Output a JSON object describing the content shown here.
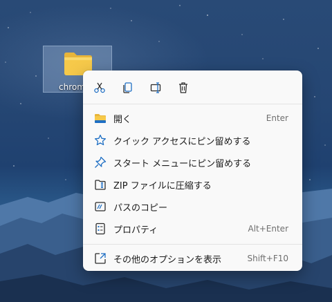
{
  "desktop": {
    "icon_label": "chrom"
  },
  "menu": {
    "toolbar": [
      {
        "name": "cut-icon",
        "label": "Cut"
      },
      {
        "name": "copy-icon",
        "label": "Copy"
      },
      {
        "name": "rename-icon",
        "label": "Rename"
      },
      {
        "name": "delete-icon",
        "label": "Delete"
      }
    ],
    "items": [
      {
        "label": "開く",
        "shortcut": "Enter",
        "icon": "folder-open-icon"
      },
      {
        "label": "クイック アクセスにピン留めする",
        "shortcut": "",
        "icon": "star-icon"
      },
      {
        "label": "スタート メニューにピン留めする",
        "shortcut": "",
        "icon": "pin-icon"
      },
      {
        "label": "ZIP ファイルに圧縮する",
        "shortcut": "",
        "icon": "zip-icon"
      },
      {
        "label": "パスのコピー",
        "shortcut": "",
        "icon": "copy-path-icon"
      },
      {
        "label": "プロパティ",
        "shortcut": "Alt+Enter",
        "icon": "properties-icon"
      },
      {
        "label": "その他のオプションを表示",
        "shortcut": "Shift+F10",
        "icon": "more-options-icon"
      }
    ]
  },
  "colors": {
    "accent": "#1f6fc4",
    "folder": "#f6c94a",
    "menu_bg": "#f9f9f9"
  }
}
